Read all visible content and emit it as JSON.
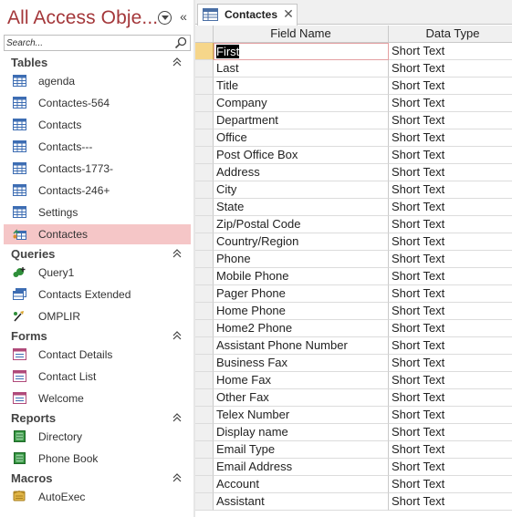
{
  "nav": {
    "title": "All Access Obje...",
    "search_placeholder": "Search...",
    "groups": {
      "tables": {
        "label": "Tables",
        "items": [
          {
            "label": "agenda",
            "icon": "table-icon"
          },
          {
            "label": "Contactes-564",
            "icon": "table-icon"
          },
          {
            "label": "Contacts",
            "icon": "table-icon"
          },
          {
            "label": "Contacts---",
            "icon": "table-icon"
          },
          {
            "label": "Contacts-1773-",
            "icon": "table-icon"
          },
          {
            "label": "Contacts-246+",
            "icon": "table-icon"
          },
          {
            "label": "Settings",
            "icon": "table-icon"
          },
          {
            "label": "Contactes",
            "icon": "linked-table-icon",
            "selected": true
          }
        ]
      },
      "queries": {
        "label": "Queries",
        "items": [
          {
            "label": "Query1",
            "icon": "append-query-icon"
          },
          {
            "label": "Contacts Extended",
            "icon": "select-query-icon"
          },
          {
            "label": "OMPLIR",
            "icon": "update-query-icon"
          }
        ]
      },
      "forms": {
        "label": "Forms",
        "items": [
          {
            "label": "Contact Details",
            "icon": "form-icon"
          },
          {
            "label": "Contact List",
            "icon": "form-icon"
          },
          {
            "label": "Welcome",
            "icon": "form-icon"
          }
        ]
      },
      "reports": {
        "label": "Reports",
        "items": [
          {
            "label": "Directory",
            "icon": "report-icon"
          },
          {
            "label": "Phone Book",
            "icon": "report-icon"
          }
        ]
      },
      "macros": {
        "label": "Macros",
        "items": [
          {
            "label": "AutoExec",
            "icon": "macro-icon"
          }
        ]
      }
    }
  },
  "document": {
    "tab_label": "Contactes",
    "columns": {
      "field_name": "Field Name",
      "data_type": "Data Type"
    },
    "rows": [
      {
        "field": "First",
        "type": "Short Text"
      },
      {
        "field": "Last",
        "type": "Short Text"
      },
      {
        "field": "Title",
        "type": "Short Text"
      },
      {
        "field": "Company",
        "type": "Short Text"
      },
      {
        "field": "Department",
        "type": "Short Text"
      },
      {
        "field": "Office",
        "type": "Short Text"
      },
      {
        "field": "Post Office Box",
        "type": "Short Text"
      },
      {
        "field": "Address",
        "type": "Short Text"
      },
      {
        "field": "City",
        "type": "Short Text"
      },
      {
        "field": "State",
        "type": "Short Text"
      },
      {
        "field": "Zip/Postal Code",
        "type": "Short Text"
      },
      {
        "field": "Country/Region",
        "type": "Short Text"
      },
      {
        "field": "Phone",
        "type": "Short Text"
      },
      {
        "field": "Mobile Phone",
        "type": "Short Text"
      },
      {
        "field": "Pager Phone",
        "type": "Short Text"
      },
      {
        "field": "Home Phone",
        "type": "Short Text"
      },
      {
        "field": "Home2 Phone",
        "type": "Short Text"
      },
      {
        "field": "Assistant Phone Number",
        "type": "Short Text"
      },
      {
        "field": "Business Fax",
        "type": "Short Text"
      },
      {
        "field": "Home Fax",
        "type": "Short Text"
      },
      {
        "field": "Other Fax",
        "type": "Short Text"
      },
      {
        "field": "Telex Number",
        "type": "Short Text"
      },
      {
        "field": "Display name",
        "type": "Short Text"
      },
      {
        "field": "Email Type",
        "type": "Short Text"
      },
      {
        "field": "Email Address",
        "type": "Short Text"
      },
      {
        "field": "Account",
        "type": "Short Text"
      },
      {
        "field": "Assistant",
        "type": "Short Text"
      }
    ]
  },
  "colors": {
    "title_red": "#a4373a",
    "selected_item_bg": "#f5c6c7",
    "row_selector_current": "#f6d68a"
  }
}
